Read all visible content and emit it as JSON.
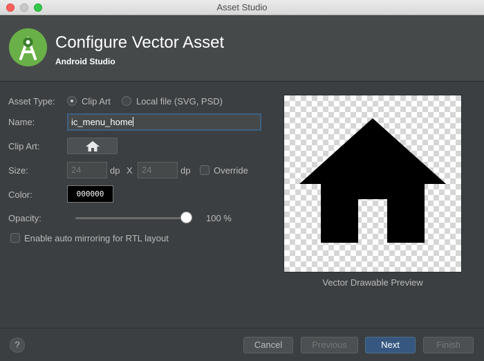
{
  "window": {
    "title": "Asset Studio"
  },
  "header": {
    "title": "Configure Vector Asset",
    "subtitle": "Android Studio",
    "logo_icon": "android-studio-logo"
  },
  "form": {
    "asset_type_label": "Asset Type:",
    "asset_type_options": [
      "Clip Art",
      "Local file (SVG, PSD)"
    ],
    "asset_type_selected": "Clip Art",
    "name_label": "Name:",
    "name_value": "ic_menu_home",
    "clip_art_label": "Clip Art:",
    "clip_art_icon": "home-icon",
    "size_label": "Size:",
    "width_value": "24",
    "height_value": "24",
    "unit_dp": "dp",
    "size_separator": "X",
    "override_label": "Override",
    "override_checked": false,
    "color_label": "Color:",
    "color_value": "000000",
    "opacity_label": "Opacity:",
    "opacity_percent": 100,
    "opacity_display": "100 %",
    "rtl_label": "Enable auto mirroring for RTL layout",
    "rtl_checked": false
  },
  "preview": {
    "caption": "Vector Drawable Preview",
    "icon": "home-icon",
    "fill_color": "#000000"
  },
  "footer": {
    "help": "?",
    "cancel": "Cancel",
    "previous": "Previous",
    "next": "Next",
    "finish": "Finish"
  },
  "colors": {
    "accent": "#365880",
    "background": "#3c3f41",
    "header": "#45494a"
  }
}
